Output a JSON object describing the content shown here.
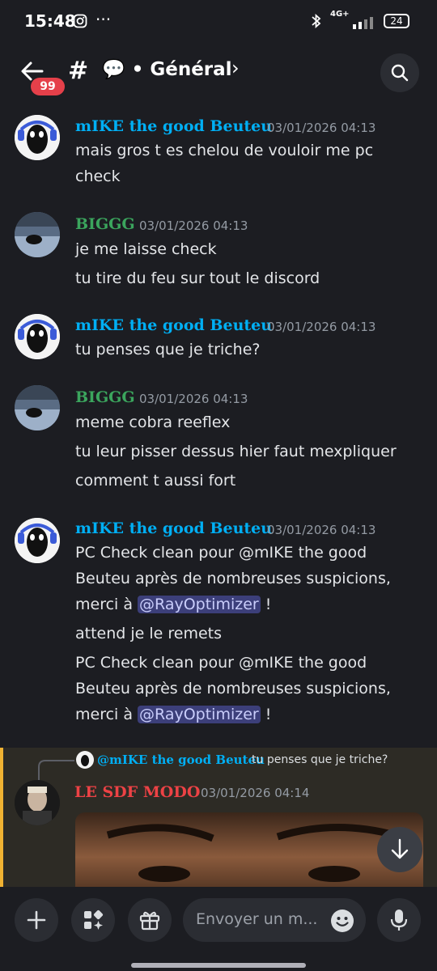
{
  "status": {
    "time": "15:48",
    "network": "4G+",
    "battery": "24"
  },
  "header": {
    "badge": "99",
    "hash": "#",
    "channel": "💬 • Général",
    "chevron": "›"
  },
  "messages": [
    {
      "author": "mIKE the good Beuteu",
      "time": "03/01/2026 04:13",
      "lines": [
        "mais gros t es chelou de vouloir me pc",
        "check"
      ]
    },
    {
      "author": "BIGGG",
      "time": "03/01/2026 04:13",
      "lines": [
        "je me laisse check",
        "tu tire du feu sur tout le discord"
      ]
    },
    {
      "author": "mIKE the good Beuteu",
      "time": "03/01/2026 04:13",
      "lines": [
        "tu penses que je triche?"
      ]
    },
    {
      "author": "BIGGG",
      "time": "03/01/2026 04:13",
      "lines": [
        "meme cobra reeflex",
        "tu leur pisser dessus hier faut mexpliquer",
        "comment t aussi fort"
      ]
    },
    {
      "author": "mIKE the good Beuteu",
      "time": "03/01/2026 04:13",
      "lines": [
        "PC Check clean pour @mIKE the good",
        "Beuteu après de nombreuses suspicions,",
        "merci à ",
        "@RayOptimizer",
        " !",
        "attend je le remets",
        "PC Check clean pour @mIKE the good",
        "Beuteu après de nombreuses suspicions,",
        "merci à ",
        "@RayOptimizer",
        " !"
      ]
    }
  ],
  "reply": {
    "ref_author": "@mIKE the good Beuteu",
    "ref_text": "tu penses que je triche?",
    "author": "LE SDF MODO",
    "time": "03/01/2026 04:14"
  },
  "composer": {
    "placeholder": "Envoyer un m..."
  },
  "colors": {
    "mike": "#00aff4",
    "biggg": "#3ba55d",
    "sdf": "#ed4245",
    "reply_accent": "#f0b232"
  }
}
